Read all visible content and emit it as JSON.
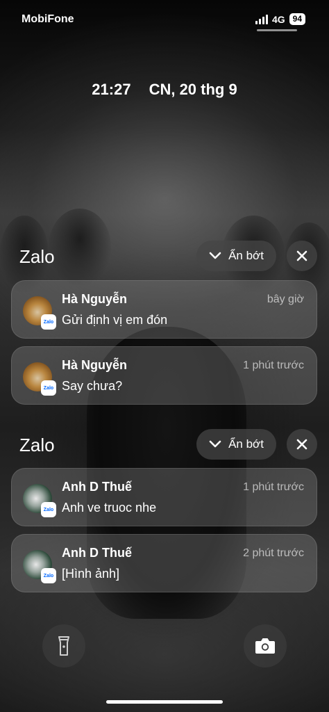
{
  "status_bar": {
    "carrier": "MobiFone",
    "network": "4G",
    "battery": "94"
  },
  "lock_screen": {
    "time": "21:27",
    "date": "CN, 20 thg 9"
  },
  "notification_groups": [
    {
      "app": "Zalo",
      "show_less_label": "Ẩn bớt",
      "notifications": [
        {
          "sender": "Hà Nguyễn",
          "time": "bây giờ",
          "message": "Gửi định vị em đón",
          "app_badge": "Zalo"
        },
        {
          "sender": "Hà Nguyễn",
          "time": "1 phút trước",
          "message": "Say chưa?",
          "app_badge": "Zalo"
        }
      ]
    },
    {
      "app": "Zalo",
      "show_less_label": "Ẩn bớt",
      "notifications": [
        {
          "sender": "Anh D Thuế",
          "time": "1 phút trước",
          "message": "Anh ve truoc nhe",
          "app_badge": "Zalo"
        },
        {
          "sender": "Anh D Thuế",
          "time": "2 phút trước",
          "message": "[Hình ảnh]",
          "app_badge": "Zalo"
        }
      ]
    }
  ],
  "controls": {
    "flashlight_icon": "flashlight-icon",
    "camera_icon": "camera-icon"
  }
}
